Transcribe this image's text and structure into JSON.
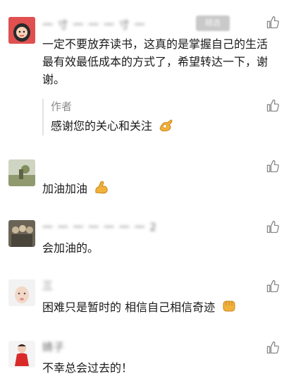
{
  "comments": [
    {
      "name": "一 寸 一 一 一 寸 一",
      "badge": "精选",
      "text": "一定不要放弃读书，这真的是掌握自己的生活最有效最低成本的方式了，希望转达一下，谢谢。",
      "avatar_icon": "girl-avatar",
      "reply": {
        "author": "作者",
        "text": "感谢您的关心和关注",
        "emoji": "ok-hand-icon"
      }
    },
    {
      "name": "",
      "text": "加油加油",
      "emoji": "flexed-biceps-icon",
      "avatar_icon": "outdoor-avatar"
    },
    {
      "name": "一 一 一 一 一 一 一 2",
      "text": "会加油的。",
      "avatar_icon": "group-photo-avatar"
    },
    {
      "name": "三",
      "text": "困难只是暂时的 相信自己相信奇迹",
      "emoji": "raised-fist-icon",
      "avatar_icon": "face-avatar"
    },
    {
      "name": "婧子",
      "text": "不幸总会过去的！",
      "avatar_icon": "red-figure-avatar"
    }
  ],
  "icons": {
    "like": "thumbs-up-icon"
  },
  "colors": {
    "name": "#8a8a8a",
    "text": "#1a1a1a",
    "icon": "#8a8a8a",
    "divider": "#e2e2e2"
  }
}
